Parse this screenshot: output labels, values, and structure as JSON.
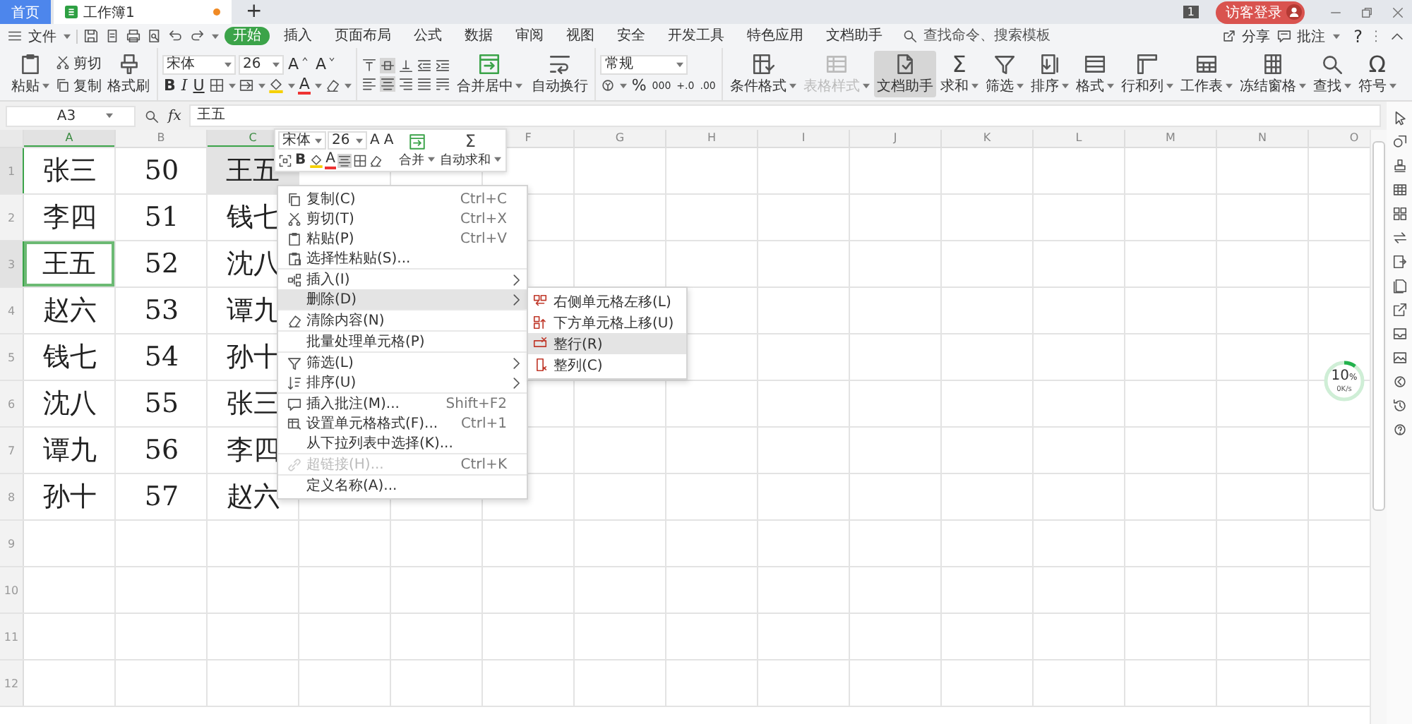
{
  "title_bar": {
    "tabs": [
      {
        "label": "首页",
        "selected": false
      },
      {
        "label": "工作簿1",
        "selected": true,
        "unsaved": true
      }
    ],
    "new_tab": "+",
    "badge": "1",
    "login": "访客登录"
  },
  "menu_bar": {
    "file": "文件",
    "tabs": [
      {
        "label": "开始",
        "selected": true
      },
      {
        "label": "插入",
        "selected": false
      },
      {
        "label": "页面布局",
        "selected": false
      },
      {
        "label": "公式",
        "selected": false
      },
      {
        "label": "数据",
        "selected": false
      },
      {
        "label": "审阅",
        "selected": false
      },
      {
        "label": "视图",
        "selected": false
      },
      {
        "label": "安全",
        "selected": false
      },
      {
        "label": "开发工具",
        "selected": false
      },
      {
        "label": "特色应用",
        "selected": false
      },
      {
        "label": "文档助手",
        "selected": false
      }
    ],
    "search": {
      "placeholder": "查找命令、搜索模板"
    },
    "share": "分享",
    "comment": "批注",
    "help": "?"
  },
  "ribbon": {
    "paste": "粘贴",
    "cut": "剪切",
    "copy": "复制",
    "format_painter": "格式刷",
    "font": {
      "name": "宋体",
      "size": "26",
      "grow": "A",
      "shrink": "A",
      "bold": "B",
      "italic": "I",
      "underline": "U",
      "color_letter": "A"
    },
    "vertical_align": [
      {
        "selected": false
      },
      {
        "selected": true
      },
      {
        "selected": false
      }
    ],
    "horizontal_align": [
      {
        "selected": false
      },
      {
        "selected": true
      },
      {
        "selected": false
      },
      {
        "selected": false
      },
      {
        "selected": false
      }
    ],
    "merge": "合并居中",
    "wrap": "自动换行",
    "number_format": "常规",
    "percent": "%",
    "thousands": "000",
    "inc_decimal": "+.0",
    "dec_decimal": ".00",
    "tools": [
      {
        "label": "条件格式",
        "dropdown": true,
        "disabled": false,
        "selected": false
      },
      {
        "label": "表格样式",
        "dropdown": true,
        "disabled": true,
        "selected": false
      },
      {
        "label": "文档助手",
        "dropdown": false,
        "disabled": false,
        "selected": true
      },
      {
        "label": "求和",
        "glyph": "Σ",
        "dropdown": true,
        "disabled": false,
        "selected": false
      },
      {
        "label": "筛选",
        "dropdown": true,
        "disabled": false,
        "selected": false
      },
      {
        "label": "排序",
        "dropdown": true,
        "disabled": false,
        "selected": false
      },
      {
        "label": "格式",
        "dropdown": true,
        "disabled": false,
        "selected": false
      },
      {
        "label": "行和列",
        "dropdown": true,
        "disabled": false,
        "selected": false
      },
      {
        "label": "工作表",
        "dropdown": true,
        "disabled": false,
        "selected": false
      },
      {
        "label": "冻结窗格",
        "dropdown": true,
        "disabled": false,
        "selected": false
      },
      {
        "label": "查找",
        "dropdown": true,
        "disabled": false,
        "selected": false
      },
      {
        "label": "符号",
        "glyph": "Ω",
        "dropdown": true,
        "disabled": false,
        "selected": false
      }
    ]
  },
  "formula_bar": {
    "cell_ref": "A3",
    "fx": "fx",
    "value": "王五"
  },
  "sheet": {
    "columns": [
      {
        "label": "A",
        "selected": true
      },
      {
        "label": "B",
        "selected": false
      },
      {
        "label": "C",
        "selected": true
      },
      {
        "label": "F",
        "selected": false
      },
      {
        "label": "G",
        "selected": false
      },
      {
        "label": "H",
        "selected": false
      },
      {
        "label": "I",
        "selected": false
      },
      {
        "label": "J",
        "selected": false
      },
      {
        "label": "K",
        "selected": false
      },
      {
        "label": "L",
        "selected": false
      },
      {
        "label": "M",
        "selected": false
      },
      {
        "label": "N",
        "selected": false
      },
      {
        "label": "O",
        "selected": false
      }
    ],
    "rows": [
      {
        "label": "1",
        "selected": true,
        "cells": [
          {
            "text": "张三",
            "selected": false,
            "highlighted": false
          },
          {
            "text": "50",
            "selected": false,
            "highlighted": false
          },
          {
            "text": "王五",
            "selected": false,
            "highlighted": true
          }
        ]
      },
      {
        "label": "2",
        "selected": false,
        "cells": [
          {
            "text": "李四",
            "selected": false,
            "highlighted": false
          },
          {
            "text": "51",
            "selected": false,
            "highlighted": false
          },
          {
            "text": "钱七",
            "selected": false,
            "highlighted": false
          }
        ]
      },
      {
        "label": "3",
        "selected": true,
        "cells": [
          {
            "text": "王五",
            "selected": true,
            "highlighted": false
          },
          {
            "text": "52",
            "selected": false,
            "highlighted": false
          },
          {
            "text": "沈八",
            "selected": false,
            "highlighted": false
          }
        ]
      },
      {
        "label": "4",
        "selected": false,
        "cells": [
          {
            "text": "赵六",
            "selected": false,
            "highlighted": false
          },
          {
            "text": "53",
            "selected": false,
            "highlighted": false
          },
          {
            "text": "谭九",
            "selected": false,
            "highlighted": false
          }
        ]
      },
      {
        "label": "5",
        "selected": false,
        "cells": [
          {
            "text": "钱七",
            "selected": false,
            "highlighted": false
          },
          {
            "text": "54",
            "selected": false,
            "highlighted": false
          },
          {
            "text": "孙十",
            "selected": false,
            "highlighted": false
          }
        ]
      },
      {
        "label": "6",
        "selected": false,
        "cells": [
          {
            "text": "沈八",
            "selected": false,
            "highlighted": false
          },
          {
            "text": "55",
            "selected": false,
            "highlighted": false
          },
          {
            "text": "张三",
            "selected": false,
            "highlighted": false
          }
        ]
      },
      {
        "label": "7",
        "selected": false,
        "cells": [
          {
            "text": "谭九",
            "selected": false,
            "highlighted": false
          },
          {
            "text": "56",
            "selected": false,
            "highlighted": false
          },
          {
            "text": "李四",
            "selected": false,
            "highlighted": false
          }
        ]
      },
      {
        "label": "8",
        "selected": false,
        "cells": [
          {
            "text": "孙十",
            "selected": false,
            "highlighted": false
          },
          {
            "text": "57",
            "selected": false,
            "highlighted": false
          },
          {
            "text": "赵六",
            "selected": false,
            "highlighted": false
          }
        ]
      },
      {
        "label": "9",
        "selected": false
      },
      {
        "label": "10",
        "selected": false
      },
      {
        "label": "11",
        "selected": false
      },
      {
        "label": "12",
        "selected": false
      }
    ]
  },
  "mini_toolbar": {
    "font": "宋体",
    "size": "26",
    "grow": "A",
    "shrink": "A",
    "bold": "B",
    "color_letter": "A",
    "align_selected": true,
    "merge": "合并",
    "sigma": "Σ",
    "autosum": "自动求和"
  },
  "context_menu": {
    "items": [
      {
        "label": "复制(C)",
        "shortcut": "Ctrl+C",
        "submenu": false,
        "disabled": false,
        "selected": false,
        "divider": false
      },
      {
        "label": "剪切(T)",
        "shortcut": "Ctrl+X",
        "submenu": false,
        "disabled": false,
        "selected": false,
        "divider": false
      },
      {
        "label": "粘贴(P)",
        "shortcut": "Ctrl+V",
        "submenu": false,
        "disabled": false,
        "selected": false,
        "divider": false
      },
      {
        "label": "选择性粘贴(S)...",
        "submenu": false,
        "disabled": false,
        "selected": false,
        "divider": false
      },
      {
        "label": "插入(I)",
        "submenu": true,
        "disabled": false,
        "selected": false,
        "divider": true
      },
      {
        "label": "删除(D)",
        "submenu": true,
        "disabled": false,
        "selected": true,
        "divider": false
      },
      {
        "label": "清除内容(N)",
        "submenu": false,
        "disabled": false,
        "selected": false,
        "divider": true
      },
      {
        "label": "批量处理单元格(P)",
        "submenu": false,
        "disabled": false,
        "selected": false,
        "divider": true
      },
      {
        "label": "筛选(L)",
        "submenu": true,
        "disabled": false,
        "selected": false,
        "divider": true
      },
      {
        "label": "排序(U)",
        "submenu": true,
        "disabled": false,
        "selected": false,
        "divider": false
      },
      {
        "label": "插入批注(M)...",
        "shortcut": "Shift+F2",
        "submenu": false,
        "disabled": false,
        "selected": false,
        "divider": true
      },
      {
        "label": "设置单元格格式(F)...",
        "shortcut": "Ctrl+1",
        "submenu": false,
        "disabled": false,
        "selected": false,
        "divider": false
      },
      {
        "label": "从下拉列表中选择(K)...",
        "submenu": false,
        "disabled": false,
        "selected": false,
        "divider": false
      },
      {
        "label": "超链接(H)...",
        "shortcut": "Ctrl+K",
        "submenu": false,
        "disabled": true,
        "selected": false,
        "divider": true
      },
      {
        "label": "定义名称(A)...",
        "submenu": false,
        "disabled": false,
        "selected": false,
        "divider": true
      }
    ]
  },
  "submenu": {
    "items": [
      {
        "label": "右侧单元格左移(L)",
        "selected": false
      },
      {
        "label": "下方单元格上移(U)",
        "selected": false
      },
      {
        "label": "整行(R)",
        "selected": true
      },
      {
        "label": "整列(C)",
        "selected": false
      }
    ]
  },
  "progress": {
    "level": 0.1,
    "percent": "10",
    "unit": "%",
    "speed": "0K/s"
  }
}
